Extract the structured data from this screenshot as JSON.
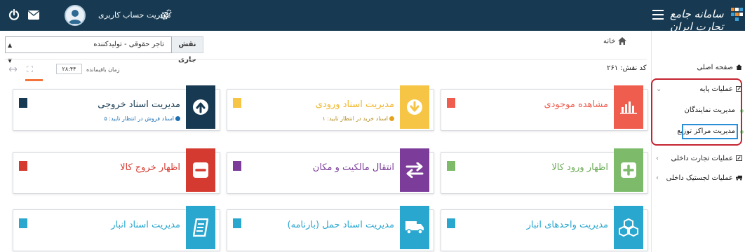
{
  "topbar": {
    "title": "سامانه جامع تجارت ایران",
    "account_label": "مدیریت حساب کاربری"
  },
  "sidebar": {
    "items": [
      {
        "label": "صفحه اصلی"
      },
      {
        "label": "عملیات پایه"
      },
      {
        "label": "مدیریت نمایندگان"
      },
      {
        "label": "مدیریت مراکز توزیع"
      },
      {
        "label": "عملیات تجارت داخلی"
      },
      {
        "label": "عملیات لجستیک داخلی"
      }
    ]
  },
  "main": {
    "breadcrumb": "خانه",
    "role_label": "نقش جاری",
    "role_value": "تاجر حقوقی - تولیدکننده",
    "role_code": "کد نقش: ۲۶۱",
    "time_label": "زمان باقیمانده",
    "time_value": "۲۸:۴۴"
  },
  "cards": [
    {
      "title": "مشاهده موجودی",
      "icon": "bar-chart-icon",
      "color": "#ef5d4f",
      "title_color": "#ef5d4f",
      "sub": ""
    },
    {
      "title": "مدیریت اسناد ورودی",
      "icon": "arrow-down-circle-icon",
      "color": "#f7c545",
      "title_color": "#f2b629",
      "sub": "اسناد خرید در انتظار تایید: ۱",
      "sub_color": "#b08a1b"
    },
    {
      "title": "مدیریت اسناد خروجی",
      "icon": "arrow-up-circle-icon",
      "color": "#173a52",
      "title_color": "#173a52",
      "sub": "اسناد فروش در انتظار تایید: ۵",
      "sub_color": "#1e6fb1"
    },
    {
      "title": "اظهار ورود کالا",
      "icon": "plus-box-icon",
      "color": "#7dbb6a",
      "title_color": "#6aaa55",
      "sub": ""
    },
    {
      "title": "انتقال مالکیت و مکان",
      "icon": "transfer-arrows-icon",
      "color": "#7b3c9a",
      "title_color": "#7b3c9a",
      "sub": ""
    },
    {
      "title": "اظهار خروج کالا",
      "icon": "minus-box-icon",
      "color": "#d53a30",
      "title_color": "#d53a30",
      "sub": ""
    },
    {
      "title": "مدیریت واحدهای انبار",
      "icon": "boxes-icon",
      "color": "#2aa7cf",
      "title_color": "#2aa7cf",
      "sub": ""
    },
    {
      "title": "مدیریت اسناد حمل (بارنامه)",
      "icon": "truck-icon",
      "color": "#2aa7cf",
      "title_color": "#2aa7cf",
      "sub": ""
    },
    {
      "title": "مدیریت اسناد انبار",
      "icon": "notebook-icon",
      "color": "#2aa7cf",
      "title_color": "#2aa7cf",
      "sub": ""
    }
  ]
}
